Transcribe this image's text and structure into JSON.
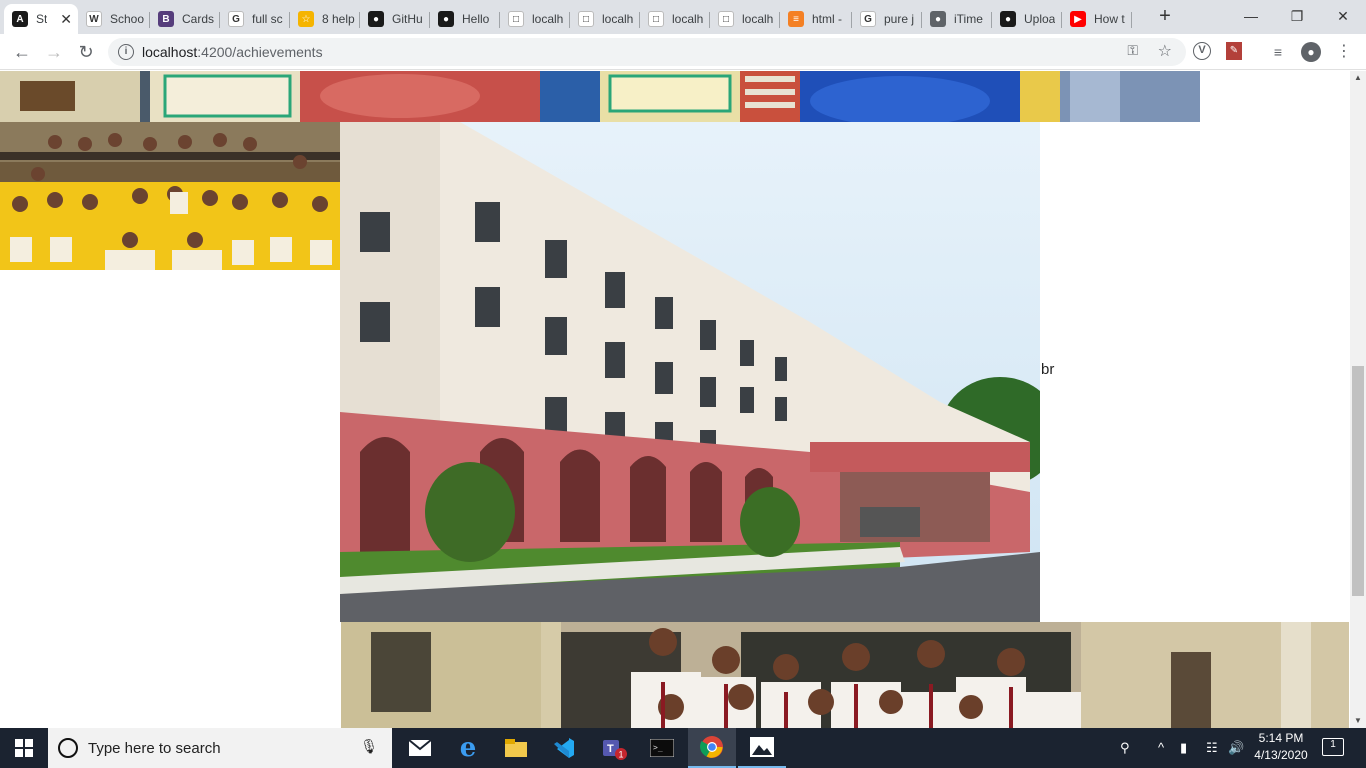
{
  "browser": {
    "tabs": [
      {
        "label": "St",
        "favicon": "angular-icon",
        "color": "#1a1a1a",
        "glyph": "A",
        "active": true
      },
      {
        "label": "Schoo",
        "favicon": "wikipedia-icon",
        "color": "#ffffff",
        "glyph": "W"
      },
      {
        "label": "Cards",
        "favicon": "bootstrap-icon",
        "color": "#563d7c",
        "glyph": "B"
      },
      {
        "label": "full sc",
        "favicon": "google-icon",
        "color": "#ffffff",
        "glyph": "G"
      },
      {
        "label": "8 help",
        "favicon": "yellow-app-icon",
        "color": "#f5b400",
        "glyph": "☆"
      },
      {
        "label": "GitHu",
        "favicon": "github-icon",
        "color": "#1a1a1a",
        "glyph": "●"
      },
      {
        "label": "Hello",
        "favicon": "github-icon",
        "color": "#1a1a1a",
        "glyph": "●"
      },
      {
        "label": "localh",
        "favicon": "localhost-icon",
        "color": "#ffffff",
        "glyph": "□"
      },
      {
        "label": "localh",
        "favicon": "localhost-icon",
        "color": "#ffffff",
        "glyph": "□"
      },
      {
        "label": "localh",
        "favicon": "localhost-icon",
        "color": "#ffffff",
        "glyph": "□"
      },
      {
        "label": "localh",
        "favicon": "localhost-icon",
        "color": "#ffffff",
        "glyph": "□"
      },
      {
        "label": "html -",
        "favicon": "stackoverflow-icon",
        "color": "#f48024",
        "glyph": "≡"
      },
      {
        "label": "pure j",
        "favicon": "google-icon",
        "color": "#ffffff",
        "glyph": "G"
      },
      {
        "label": "iTime",
        "favicon": "globe-icon",
        "color": "#5f6368",
        "glyph": "●"
      },
      {
        "label": "Uploa",
        "favicon": "github-icon",
        "color": "#1a1a1a",
        "glyph": "●"
      },
      {
        "label": "How t",
        "favicon": "youtube-icon",
        "color": "#ff0000",
        "glyph": "▶"
      }
    ],
    "new_tab_symbol": "+",
    "window_buttons": {
      "minimize": "—",
      "maximize": "❐",
      "close": "✕"
    },
    "url": {
      "host": "localhost",
      "path": ":4200/achievements"
    },
    "nav": {
      "back": "←",
      "forward": "→",
      "reload": "↻"
    }
  },
  "page": {
    "stray_text": "br",
    "images": [
      {
        "name": "award-ceremony-banner",
        "description": "banner"
      },
      {
        "name": "student-team-photo"
      },
      {
        "name": "school-building-photo"
      },
      {
        "name": "students-group-photo"
      }
    ]
  },
  "taskbar": {
    "search_placeholder": "Type here to search",
    "time": "5:14 PM",
    "date": "4/13/2020",
    "notification_count": "1",
    "accent": "#76b9ed"
  }
}
